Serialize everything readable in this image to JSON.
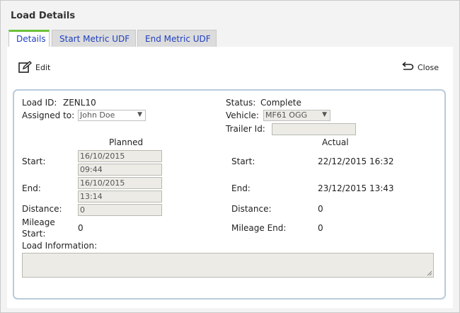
{
  "window": {
    "title": "Load Details"
  },
  "tabs": [
    {
      "label": "Details"
    },
    {
      "label": "Start Metric UDF"
    },
    {
      "label": "End Metric UDF"
    }
  ],
  "toolbar": {
    "edit_label": "Edit",
    "close_label": "Close"
  },
  "details": {
    "load_id_label": "Load ID:",
    "load_id_value": "ZENL10",
    "assigned_label": "Assigned to:",
    "assigned_value": "John Doe",
    "status_label": "Status:",
    "status_value": "Complete",
    "vehicle_label": "Vehicle:",
    "vehicle_value": "MF61 OGG",
    "trailer_label": "Trailer Id:",
    "trailer_value": ""
  },
  "planned": {
    "header": "Planned",
    "start_label": "Start:",
    "start_date": "16/10/2015",
    "start_time": "09:44",
    "end_label": "End:",
    "end_date": "16/10/2015",
    "end_time": "13:14",
    "distance_label": "Distance:",
    "distance_value": "0",
    "mileage_label_1": "Mileage",
    "mileage_label_2": "Start:",
    "mileage_value": "0"
  },
  "actual": {
    "header": "Actual",
    "start_label": "Start:",
    "start_value": "22/12/2015 16:32",
    "end_label": "End:",
    "end_value": "23/12/2015 13:43",
    "distance_label": "Distance:",
    "distance_value": "0",
    "mileage_label": "Mileage End:",
    "mileage_value": "0"
  },
  "load_info": {
    "label": "Load Information:",
    "value": ""
  }
}
